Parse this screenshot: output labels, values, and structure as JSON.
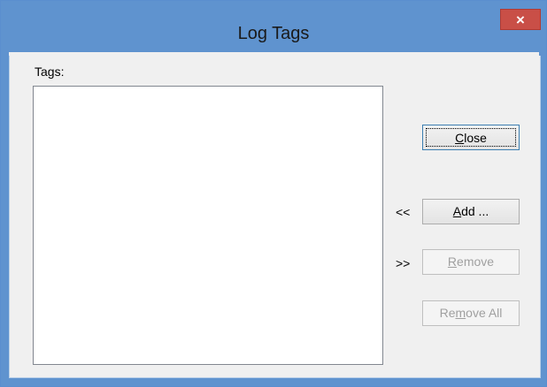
{
  "window": {
    "title": "Log Tags",
    "close_glyph": "×"
  },
  "tags": {
    "label": "Tags:",
    "items": []
  },
  "buttons": {
    "close": {
      "prefix": "",
      "mnemonic": "C",
      "rest": "lose"
    },
    "add": {
      "prefix": "",
      "mnemonic": "A",
      "rest": "dd ..."
    },
    "remove": {
      "prefix": "",
      "mnemonic": "R",
      "rest": "emove"
    },
    "remove_all": {
      "prefix": "Re",
      "mnemonic": "m",
      "rest": "ove All"
    }
  },
  "arrows": {
    "add": "<<",
    "remove": ">>"
  },
  "colors": {
    "titlebar": "#5f93cf",
    "close_button": "#c94f47"
  }
}
